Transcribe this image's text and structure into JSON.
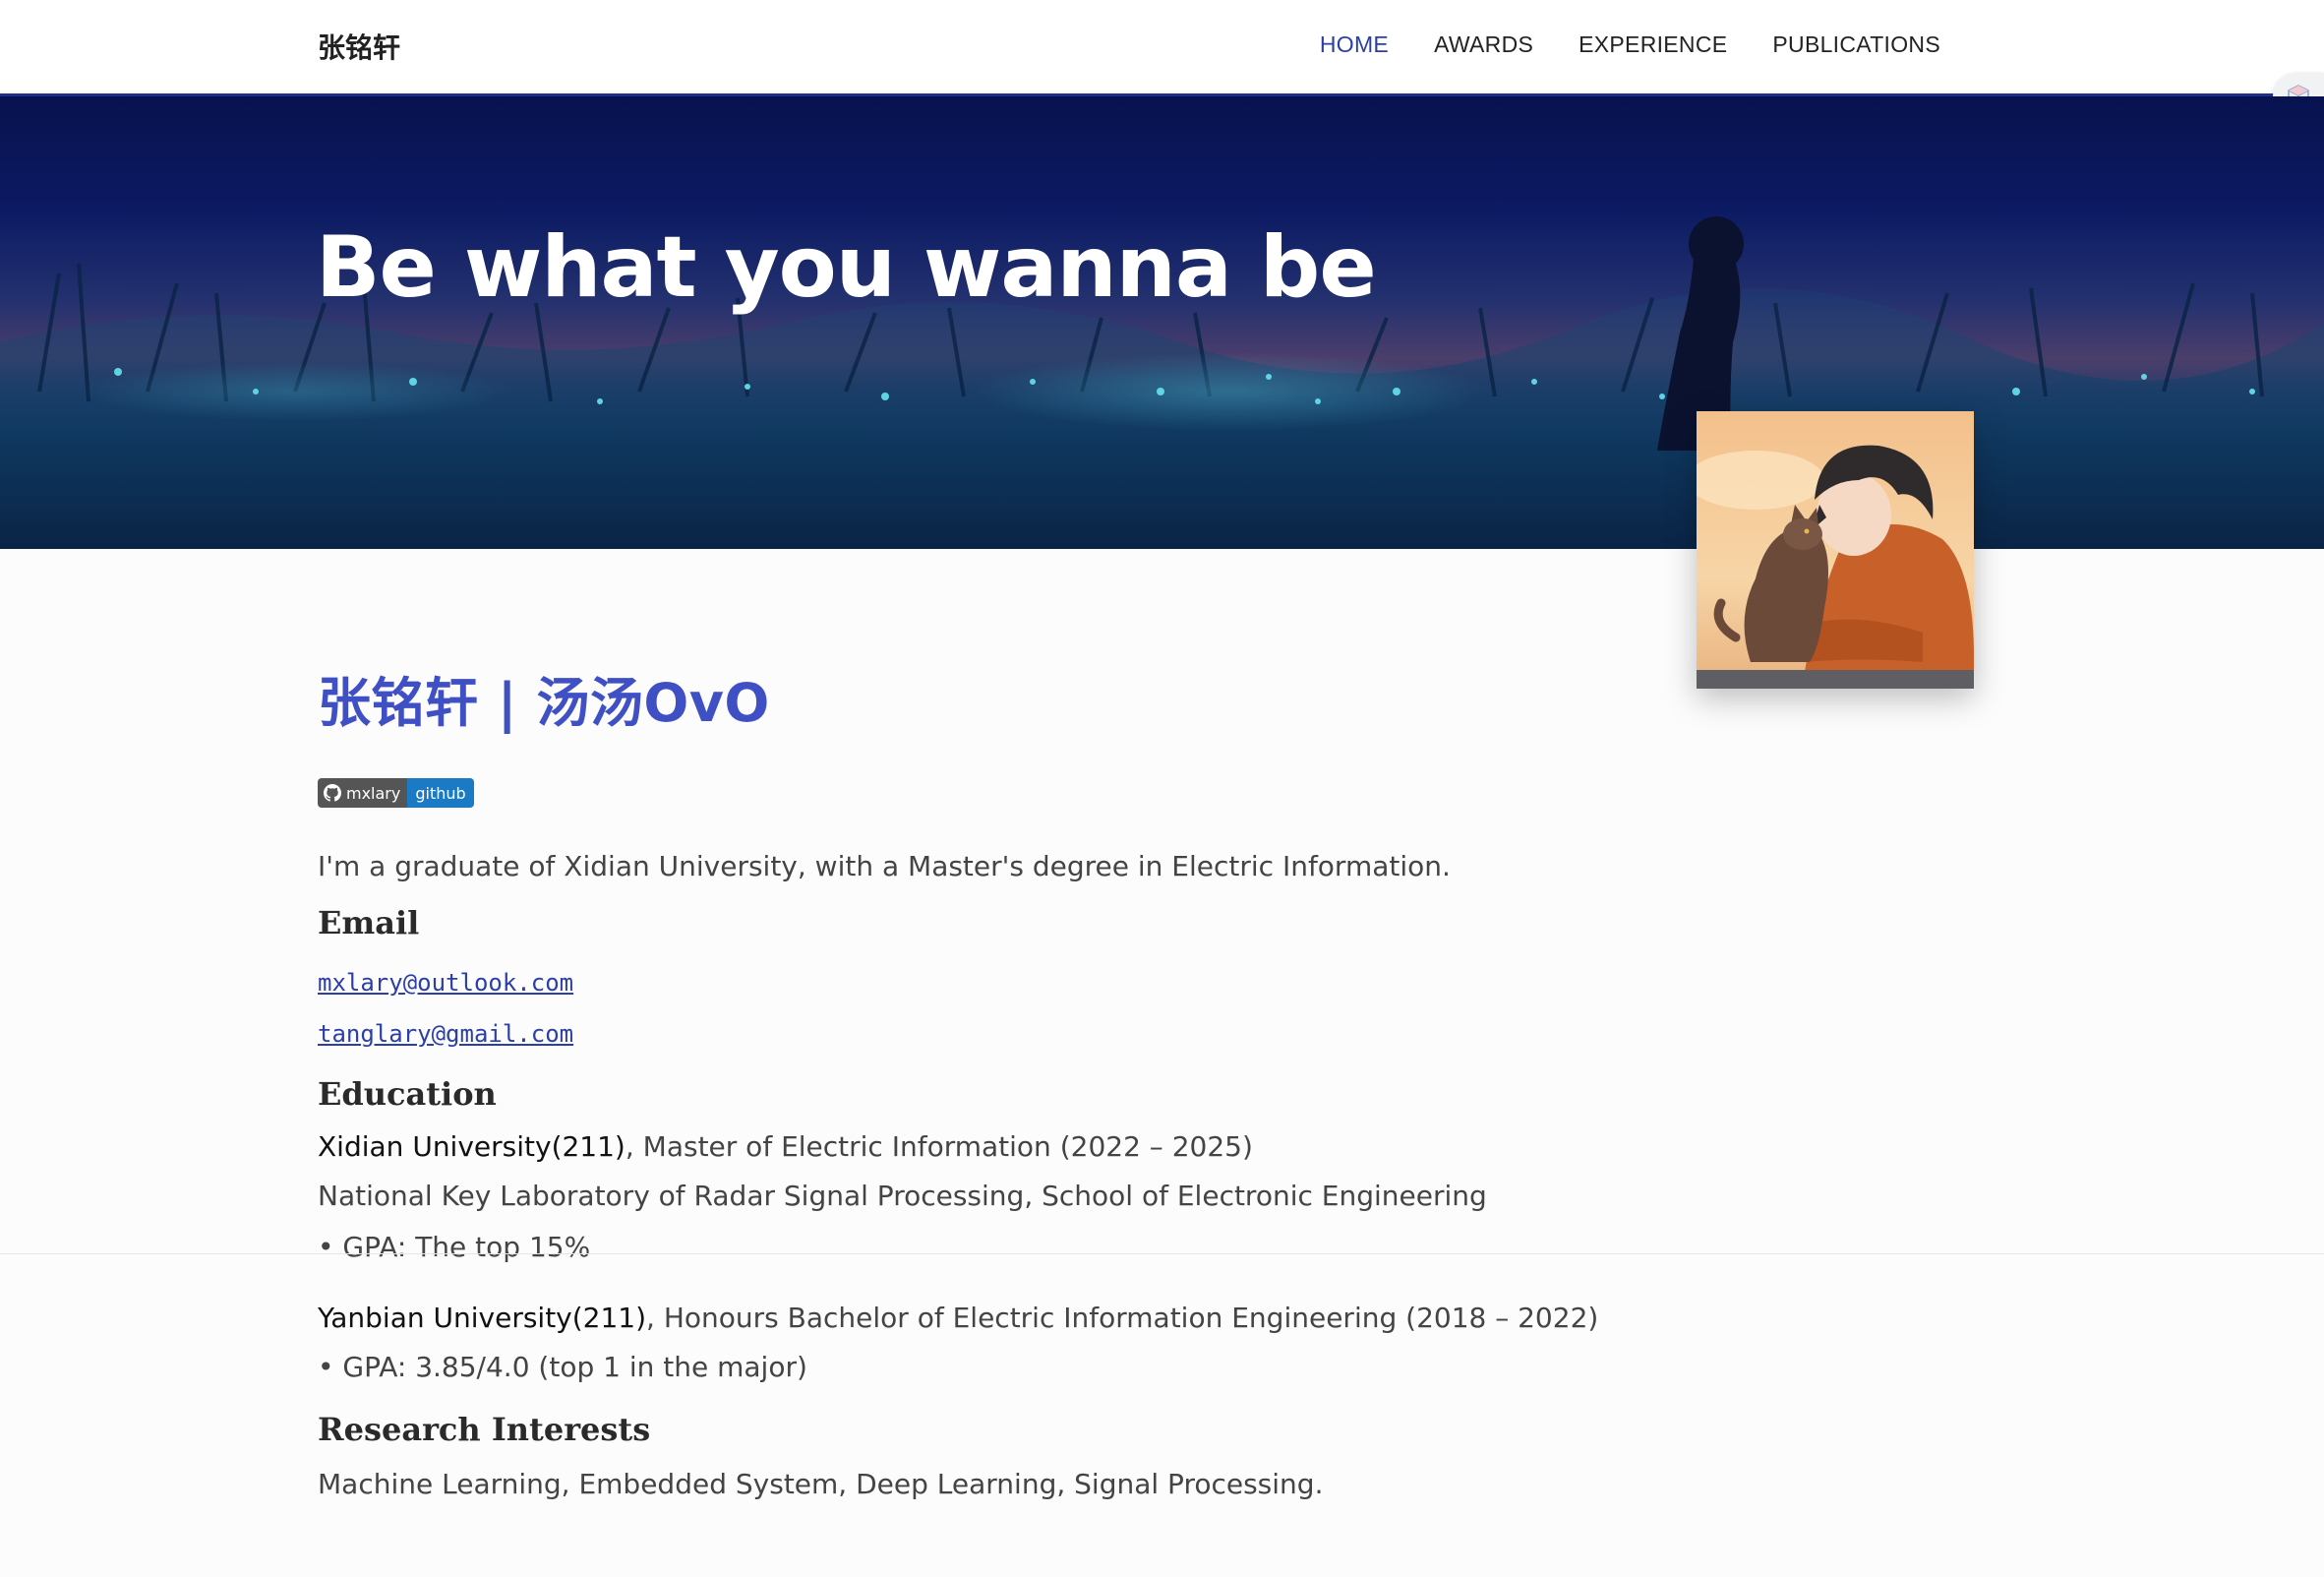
{
  "navbar": {
    "brand": "张铭轩",
    "links": [
      "HOME",
      "AWARDS",
      "EXPERIENCE",
      "PUBLICATIONS"
    ],
    "active": "HOME"
  },
  "hero": {
    "title": "Be what you wanna be"
  },
  "profile": {
    "title": "张铭轩 | 汤汤OvO",
    "badge": {
      "left_label": "mxlary",
      "right_label": "github",
      "icon": "github-icon"
    },
    "intro": "I'm a graduate of Xidian University, with a Master's degree in Electric Information."
  },
  "email": {
    "heading": "Email",
    "addresses": [
      "mxlary@outlook.com",
      "tanglary@gmail.com"
    ]
  },
  "education": {
    "heading": "Education",
    "entries": [
      {
        "school": "Xidian University(211)",
        "degree": ", Master of Electric Information (2022 – 2025)",
        "detail": "National Key Laboratory of Radar Signal Processing, School of Electronic Engineering",
        "gpa": "• GPA: The top 15%"
      },
      {
        "school": "Yanbian University(211)",
        "degree": ", Honours Bachelor of Electric Information Engineering (2018 – 2022)",
        "gpa": "• GPA: 3.85/4.0 (top 1 in the major)"
      }
    ]
  },
  "research": {
    "heading": "Research Interests",
    "text": "Machine Learning, Embedded System, Deep Learning, Signal Processing."
  },
  "colors": {
    "accent": "#3f4fc4",
    "nav_active": "#2b3fa6",
    "nav_border": "#1f2f8f",
    "badge_left": "#555555",
    "badge_right": "#1b7ac5"
  }
}
